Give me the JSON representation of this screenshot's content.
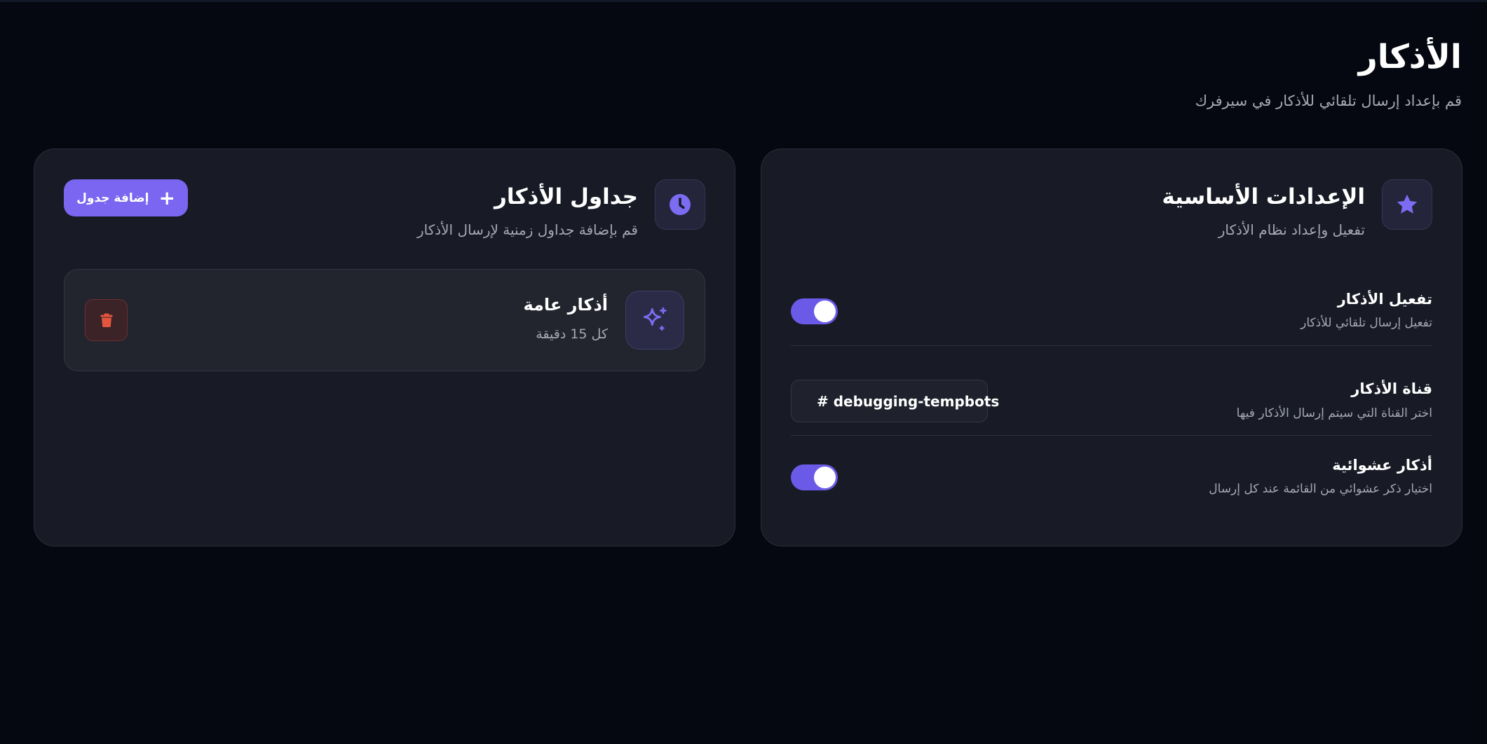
{
  "page": {
    "title": "الأذكار",
    "subtitle": "قم بإعداد إرسال تلقائي للأذكار في سيرفرك"
  },
  "basic_settings": {
    "icon": "star-icon",
    "title": "الإعدادات الأساسية",
    "description": "تفعيل وإعداد نظام الأذكار",
    "enable": {
      "label": "تفعيل الأذكار",
      "hint": "تفعيل إرسال تلقائي للأذكار",
      "checked": true
    },
    "channel": {
      "label": "قناة الأذكار",
      "hint": "اختر القناة التي سيتم إرسال الأذكار فيها",
      "selected_value": "# debugging-tempbots",
      "icon": "chevron-down-icon"
    },
    "random": {
      "label": "أذكار عشوائية",
      "hint": "اختيار ذكر عشوائي من القائمة عند كل إرسال",
      "checked": true
    }
  },
  "schedules": {
    "icon": "clock-icon",
    "title": "جداول الأذكار",
    "description": "قم بإضافة جداول زمنية لإرسال الأذكار",
    "add_button_label": "إضافة جدول",
    "items": [
      {
        "icon": "sparkle-icon",
        "name": "أذكار عامة",
        "interval": "كل 15 دقيقة",
        "delete_icon": "trash-icon"
      }
    ]
  },
  "colors": {
    "background": "#050810",
    "card": "#181b25",
    "accent": "#7a66f0",
    "danger": "#e4553f"
  }
}
